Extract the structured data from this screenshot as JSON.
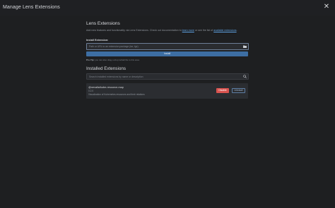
{
  "window": {
    "title": "Manage Lens Extensions",
    "close_icon": "close-icon"
  },
  "main": {
    "heading": "Lens Extensions",
    "description_prefix": "Add new features and functionality via Lens Extensions. Check out documentation to ",
    "description_link1": "learn more",
    "description_mid": " or see the list of ",
    "description_link2": "available extensions",
    "description_suffix": ".",
    "install_label": "Install Extension:",
    "install_placeholder": "Path or URL to an extension package (tar, tgz)",
    "install_button": "Install",
    "pro_tip_label": "Pro-Tip:",
    "pro_tip_text": " you can also drag-n-drop tarball file to this area",
    "installed_heading": "Installed Extensions",
    "search_placeholder": "Search installed extensions by name or description"
  },
  "extensions": [
    {
      "name": "@nevalla/kube-resource-map",
      "version": "0.2.0",
      "description": "Visualization of Kubernetes resources and their relations",
      "disable_label": "Disable",
      "uninstall_label": "Uninstall"
    }
  ],
  "colors": {
    "background": "#1e1f21",
    "accent": "#3d6ea3",
    "danger": "#d9534f",
    "link": "#5fa4e6"
  }
}
